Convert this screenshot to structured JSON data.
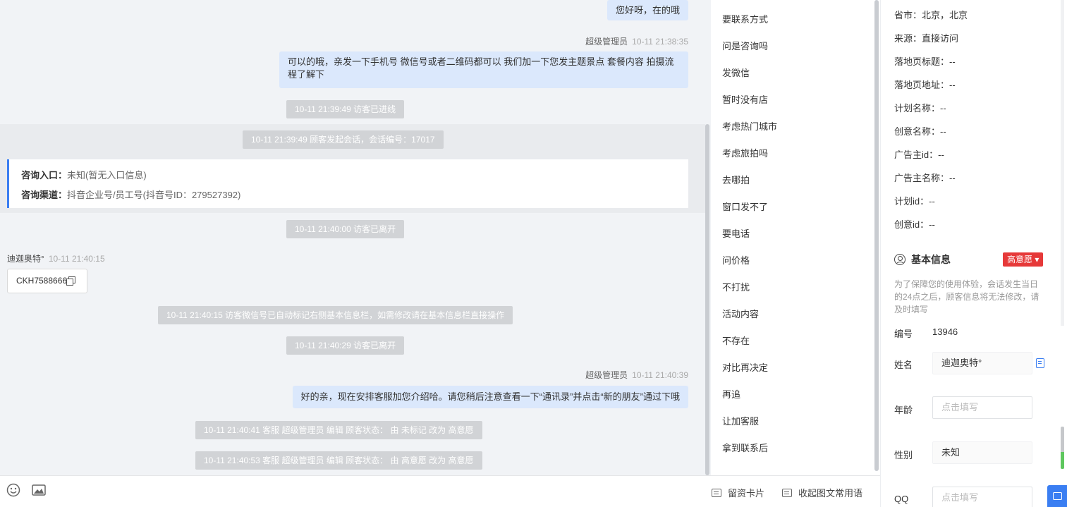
{
  "chat": {
    "messages": [
      {
        "text": "您好呀，在的哦"
      },
      {
        "sender": "超级管理员",
        "time": "10-11 21:38:35",
        "text": "可以的哦，亲发一下手机号 微信号或者二维码都可以 我们加一下您发主题景点 套餐内容 拍摄流程了解下"
      },
      {
        "sys": "10-11 21:39:49 访客已进线"
      },
      {
        "sys": "10-11 21:39:49 顾客发起会话，会话编号：17017"
      },
      {
        "sys": "10-11 21:40:00 访客已离开"
      },
      {
        "sender": "迪迦奥特°",
        "time": "10-11 21:40:15",
        "chip": "CKH7588666"
      },
      {
        "sys": "10-11 21:40:15 访客微信号已自动标记右侧基本信息栏，如需修改请在基本信息栏直接操作"
      },
      {
        "sys": "10-11 21:40:29 访客已离开"
      },
      {
        "sender": "超级管理员",
        "time": "10-11 21:40:39",
        "text": "好的亲，现在安排客服加您介绍哈。请您稍后注意查看一下“通讯录”并点击“新的朋友”通过下哦"
      },
      {
        "sys": "10-11 21:40:41 客服 超级管理员 编辑 顾客状态： 由 未标记 改为 高意愿"
      },
      {
        "sys": "10-11 21:40:53 客服 超级管理员 编辑 顾客状态： 由 高意愿 改为 高意愿"
      }
    ],
    "info_card": {
      "entry_label": "咨询入口：",
      "entry_value": "未知(暂无入口信息)",
      "channel_label": "咨询渠道：",
      "channel_value": "抖音企业号/员工号(抖音号ID：279527392)"
    }
  },
  "toolbar": {
    "emoji_icon": "emoji-icon",
    "image_icon": "image-icon",
    "card_label": "留资卡片",
    "phrases_label": "收起图文常用语"
  },
  "quick_replies": [
    "要联系方式",
    "问是咨询吗",
    "发微信",
    "暂时没有店",
    "考虑热门城市",
    "考虑旅拍吗",
    "去哪拍",
    "窗口发不了",
    "要电话",
    "问价格",
    "不打扰",
    "活动内容",
    "不存在",
    "对比再决定",
    "再追",
    "让加客服",
    "拿到联系后"
  ],
  "side": {
    "source_fields": [
      {
        "label": "省市：",
        "value": "北京，北京"
      },
      {
        "label": "来源：",
        "value": "直接访问"
      },
      {
        "label": "落地页标题：",
        "value": "--"
      },
      {
        "label": "落地页地址：",
        "value": "--"
      },
      {
        "label": "计划名称：",
        "value": "--"
      },
      {
        "label": "创意名称：",
        "value": "--"
      },
      {
        "label": "广告主id：",
        "value": "--"
      },
      {
        "label": "广告主名称：",
        "value": "--"
      },
      {
        "label": "计划id：",
        "value": "--"
      },
      {
        "label": "创意id：",
        "value": "--"
      }
    ],
    "basic_title": "基本信息",
    "intent_badge": "高意愿 ▾",
    "notice": "为了保障您的使用体验，会话发生当日的24点之后，顾客信息将无法修改，请及时填写",
    "id_label": "编号",
    "id_value": "13946",
    "name_label": "姓名",
    "name_value": "迪迦奥特°",
    "age_label": "年龄",
    "age_placeholder": "点击填写",
    "gender_label": "性别",
    "gender_value": "未知",
    "qq_label": "QQ",
    "qq_placeholder": "点击填写"
  },
  "colors": {
    "accent": "#3a7ef2",
    "badge": "#e63939",
    "bubble": "#dbe8fc",
    "system": "#d1d3d6"
  }
}
